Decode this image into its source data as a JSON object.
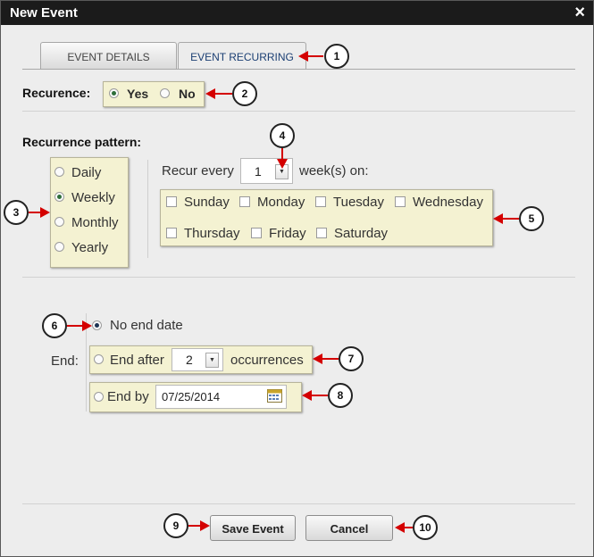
{
  "dialog": {
    "title": "New Event",
    "close_icon": "×"
  },
  "tabs": [
    {
      "label": "EVENT DETAILS",
      "active": false
    },
    {
      "label": "EVENT RECURRING",
      "active": true
    }
  ],
  "recurrence": {
    "label": "Recurence:",
    "yes": "Yes",
    "no": "No",
    "selected": "Yes"
  },
  "pattern": {
    "label": "Recurrence pattern:",
    "options": [
      "Daily",
      "Weekly",
      "Monthly",
      "Yearly"
    ],
    "selected": "Weekly",
    "recur_every_label": "Recur every",
    "recur_every_value": "1",
    "weeks_on_label": "week(s) on:",
    "days": [
      "Sunday",
      "Monday",
      "Tuesday",
      "Wednesday",
      "Thursday",
      "Friday",
      "Saturday"
    ]
  },
  "end": {
    "label": "End:",
    "no_end_date": "No end date",
    "end_after": "End after",
    "end_after_value": "2",
    "occurrences": "occurrences",
    "end_by": "End by",
    "end_by_value": "07/25/2014",
    "selected": "No end date"
  },
  "buttons": {
    "save": "Save Event",
    "cancel": "Cancel"
  },
  "callouts": [
    "1",
    "2",
    "3",
    "4",
    "5",
    "6",
    "7",
    "8",
    "9",
    "10"
  ],
  "colors": {
    "titlebar": "#1b1b1b",
    "panel": "#f4f2d2",
    "arrow": "#d40000",
    "active_tab_text": "#1b3f73"
  }
}
